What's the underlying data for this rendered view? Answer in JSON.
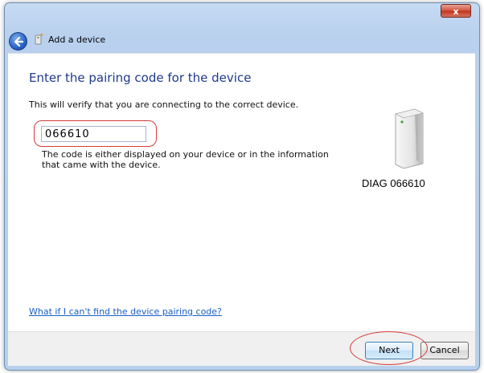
{
  "window": {
    "close_label": "x"
  },
  "header": {
    "title": "Add a device"
  },
  "main": {
    "heading": "Enter the pairing code for the device",
    "intro": "This will verify that you are connecting to the correct device.",
    "code_value": "066610",
    "help_text": "The code is either displayed on your device or in the information that came with the device.",
    "help_link": "What if I can't find the device pairing code?"
  },
  "device": {
    "name": "DIAG 066610"
  },
  "footer": {
    "next_label": "Next",
    "cancel_label": "Cancel"
  },
  "colors": {
    "accent_heading": "#1e3a8a",
    "link": "#1a5ec4",
    "highlight": "#d43a3a"
  }
}
